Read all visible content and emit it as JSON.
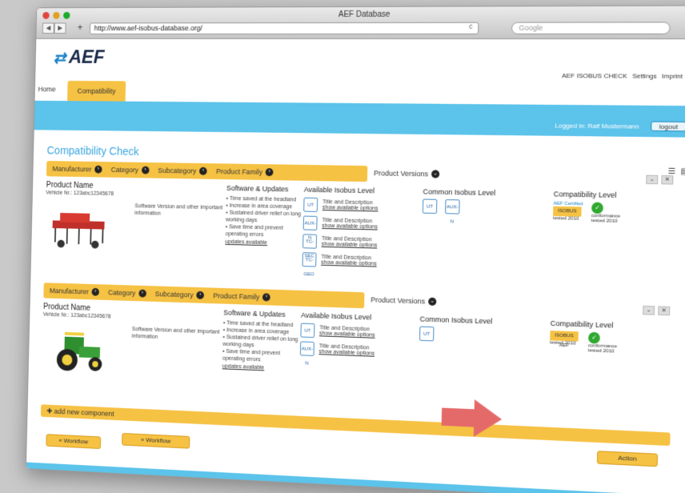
{
  "browser": {
    "title": "AEF Database",
    "url": "http://www.aef-isobus-database.org/",
    "search_placeholder": "Google",
    "nav_back": "◀",
    "nav_forward": "▶"
  },
  "site": {
    "logo_text": "AEF",
    "top_links": [
      "AEF ISOBUS CHECK",
      "Settings",
      "Imprint"
    ],
    "tabs": [
      "Home",
      "Compatibility"
    ],
    "logged_in_text": "Logged in: Ralf Mustermann",
    "logout_label": "logout"
  },
  "page": {
    "title": "Compatibility Check"
  },
  "cards": [
    {
      "crumbs": [
        "Manufacturer",
        "Category",
        "Subcategory",
        "Product Family"
      ],
      "crumb_last": "Product Versions",
      "product_name": "Product Name",
      "vehicle_nr": "Vehicle Nr.: 123abc12345678",
      "software_text": "Software Version and other important information",
      "updates_heading": "Software & Updates",
      "updates": [
        "Time saved at the headland",
        "Increase in area coverage",
        "Sustained driver relief on long working days",
        "Save time and prevent operating errors"
      ],
      "updates_link": "updates available",
      "levels_heading": "Available Isobus Level",
      "levels": [
        {
          "badge": "UT",
          "title": "Title and Description",
          "link": "show available options"
        },
        {
          "badge": "AUX-N",
          "title": "Title and Description",
          "link": "show available options"
        },
        {
          "badge": "TC-SEC",
          "title": "Title and Description",
          "link": "show available options"
        },
        {
          "badge": "TC-GEO",
          "title": "Title and Description",
          "link": "show available options"
        }
      ],
      "common_heading": "Common Isobus Level",
      "common_badges": [
        "UT",
        "AUX-N"
      ],
      "compat_heading": "Compatibility Level",
      "compat_badge_top": "AEF Certified",
      "compat_badge_tag": "ISOBUS",
      "compat_tested": "tested 2010",
      "compat_conf": "conformance tested 2010",
      "machine": "seed drill"
    },
    {
      "crumbs": [
        "Manufacturer",
        "Category",
        "Subcategory",
        "Product Family"
      ],
      "crumb_last": "Product Versions",
      "product_name": "Product Name",
      "vehicle_nr": "Vehicle Nr.: 123abc12345678",
      "software_text": "Software Version and other important information",
      "updates_heading": "Software & Updates",
      "updates": [
        "Time saved at the headland",
        "Increase in area coverage",
        "Sustained driver relief on long working days",
        "Save time and prevent operating errors"
      ],
      "updates_link": "updates available",
      "levels_heading": "Available Isobus Level",
      "levels": [
        {
          "badge": "UT",
          "title": "Title and Description",
          "link": "show available options"
        },
        {
          "badge": "AUX-N",
          "title": "Title and Description",
          "link": "show available options"
        }
      ],
      "common_heading": "Common Isobus Level",
      "common_badges": [
        "UT"
      ],
      "compat_heading": "Compatibility Level",
      "compat_badge_top": "",
      "compat_badge_tag": "ISOBUS AEF",
      "compat_tested": "tested 2010",
      "compat_conf": "conformance tested 2010",
      "machine": "tractor"
    }
  ],
  "actions": {
    "add_component": "add new component",
    "action_label": "Action",
    "workflow_left": "« Workflow",
    "workflow_right": "» Workflow"
  },
  "colors": {
    "accent_yellow": "#f6c244",
    "accent_blue": "#5cc3ea",
    "title_blue": "#3aa5df",
    "arrow_red": "#e46a6a"
  }
}
